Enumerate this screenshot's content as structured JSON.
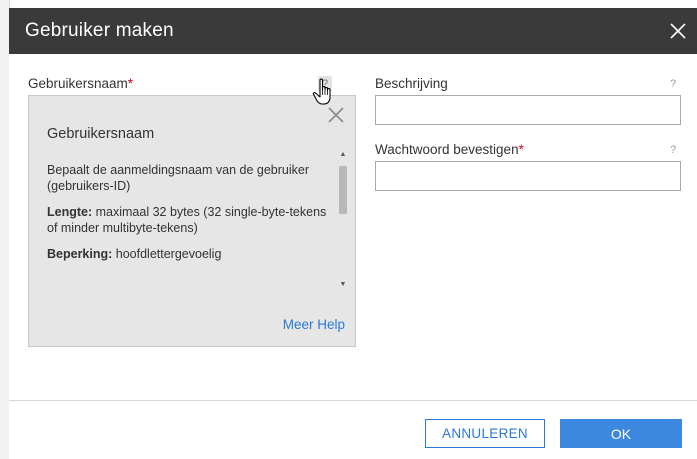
{
  "dialog": {
    "title": "Gebruiker maken",
    "close_icon": "close-icon"
  },
  "form": {
    "username": {
      "label": "Gebruikersnaam",
      "required_mark": "*",
      "help": "?"
    },
    "description": {
      "label": "Beschrijving",
      "help": "?",
      "value": ""
    },
    "confirm_password": {
      "label": "Wachtwoord bevestigen",
      "required_mark": "*",
      "help": "?",
      "value": ""
    }
  },
  "help_popover": {
    "title": "Gebruikersnaam",
    "paragraph1": "Bepaalt de aanmeldingsnaam van de gebruiker (gebruikers-ID)",
    "length_label": "Lengte:",
    "length_text": " maximaal 32 bytes (32 single-byte-tekens of minder multibyte-tekens)",
    "restriction_label": "Beperking:",
    "restriction_text": " hoofdlettergevoelig",
    "more_help": "Meer Help"
  },
  "buttons": {
    "cancel": "ANNULEREN",
    "ok": "OK"
  },
  "colors": {
    "header_bg": "#3a3a3a",
    "accent": "#3c87e0",
    "link": "#2a7ad5",
    "required": "#d0021b"
  }
}
